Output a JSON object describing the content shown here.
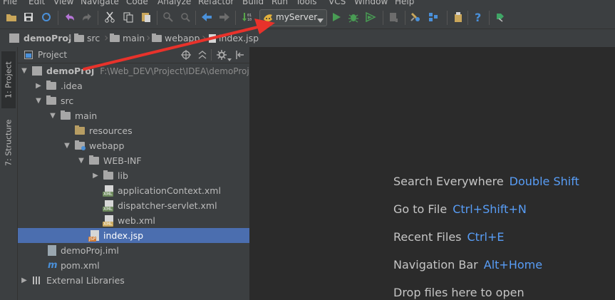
{
  "menu": [
    "File",
    "Edit",
    "View",
    "Navigate",
    "Code",
    "Analyze",
    "Refactor",
    "Build",
    "Run",
    "Tools",
    "VCS",
    "Window",
    "Help"
  ],
  "toolbar": {
    "run_config": "myServer"
  },
  "breadcrumb": [
    "demoProj",
    "src",
    "main",
    "webapp",
    "index.jsp"
  ],
  "side_tabs": {
    "project": "1: Project",
    "structure": "7: Structure"
  },
  "project_panel": {
    "title": "Project"
  },
  "tree": [
    {
      "label": "demoProj",
      "path": "F:\\Web_DEV\\Project\\IDEA\\demoProj",
      "bold": true
    },
    {
      "label": ".idea"
    },
    {
      "label": "src"
    },
    {
      "label": "main"
    },
    {
      "label": "resources"
    },
    {
      "label": "webapp"
    },
    {
      "label": "WEB-INF"
    },
    {
      "label": "lib"
    },
    {
      "label": "applicationContext.xml"
    },
    {
      "label": "dispatcher-servlet.xml"
    },
    {
      "label": "web.xml"
    },
    {
      "label": "index.jsp",
      "selected": true
    },
    {
      "label": "demoProj.iml"
    },
    {
      "label": "pom.xml"
    },
    {
      "label": "External Libraries"
    }
  ],
  "editor_hints": [
    {
      "text": "Search Everywhere",
      "key": "Double Shift"
    },
    {
      "text": "Go to File",
      "key": "Ctrl+Shift+N"
    },
    {
      "text": "Recent Files",
      "key": "Ctrl+E"
    },
    {
      "text": "Navigation Bar",
      "key": "Alt+Home"
    },
    {
      "text": "Drop files here to open",
      "key": ""
    }
  ],
  "colors": {
    "selection": "#4b6eaf",
    "shortcut": "#589df6",
    "annotation_arrow": "#e8322b"
  }
}
